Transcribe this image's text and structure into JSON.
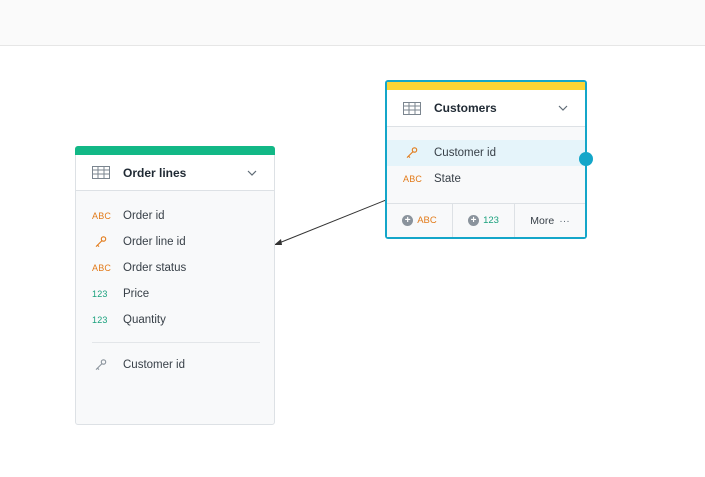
{
  "order_lines": {
    "title": "Order lines",
    "stripe_color": "#12b886",
    "fields": [
      {
        "type": "ABC",
        "label": "Order id"
      },
      {
        "type": "key",
        "label": "Order line id"
      },
      {
        "type": "ABC",
        "label": "Order status"
      },
      {
        "type": "123",
        "label": "Price"
      },
      {
        "type": "123",
        "label": "Quantity"
      }
    ],
    "reference_fields": [
      {
        "type": "key",
        "label": "Customer id"
      }
    ]
  },
  "customers": {
    "title": "Customers",
    "stripe_color": "#fcd535",
    "fields": [
      {
        "type": "key",
        "label": "Customer id",
        "highlighted": true
      },
      {
        "type": "ABC",
        "label": "State"
      }
    ],
    "footer": {
      "add_text_label": "ABC",
      "add_number_label": "123",
      "more_label": "More",
      "more_icon": "···"
    }
  },
  "icons": {
    "table": "table-icon",
    "chevron": "chevron-down-icon",
    "key": "key-icon",
    "plus": "plus-icon"
  },
  "colors": {
    "selection": "#14a6c9",
    "text_type": "#e27b1a",
    "number_type": "#1aa17d"
  }
}
